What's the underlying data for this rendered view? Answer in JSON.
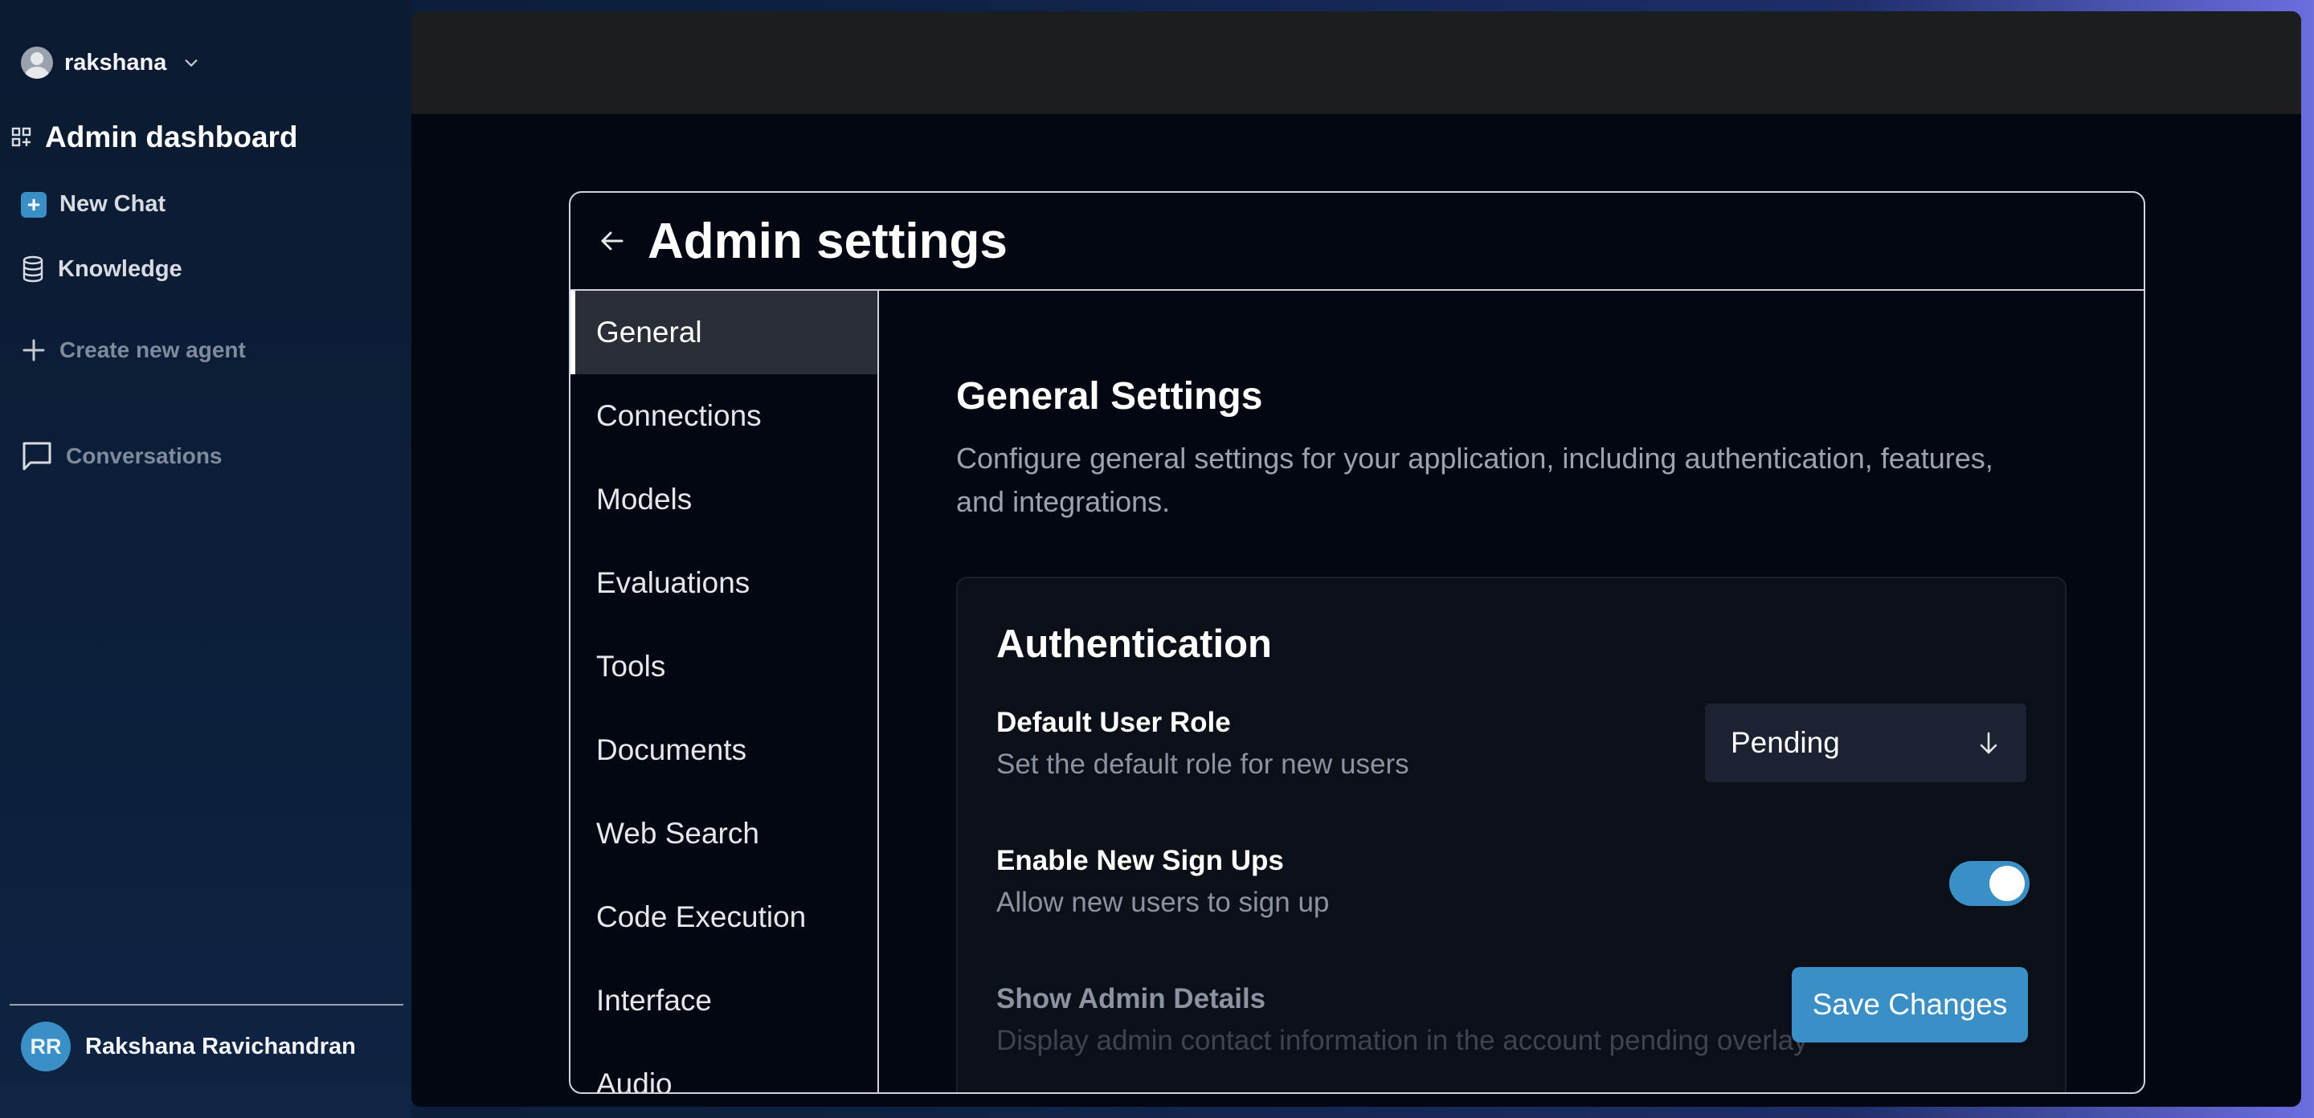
{
  "sidebar": {
    "user_name": "rakshana",
    "admin_title": "Admin dashboard",
    "new_chat": "New Chat",
    "knowledge": "Knowledge",
    "create_agent": "Create new agent",
    "conversations": "Conversations",
    "bottom_user": {
      "initials": "RR",
      "name": "Rakshana Ravichandran"
    }
  },
  "panel": {
    "title": "Admin settings",
    "tabs": [
      {
        "label": "General",
        "active": true
      },
      {
        "label": "Connections"
      },
      {
        "label": "Models"
      },
      {
        "label": "Evaluations"
      },
      {
        "label": "Tools"
      },
      {
        "label": "Documents"
      },
      {
        "label": "Web Search"
      },
      {
        "label": "Code Execution"
      },
      {
        "label": "Interface"
      },
      {
        "label": "Audio"
      }
    ],
    "section_title": "General Settings",
    "section_desc": "Configure general settings for your application, including authentication, features, and integrations.",
    "auth": {
      "title": "Authentication",
      "default_role_label": "Default User Role",
      "default_role_desc": "Set the default role for new users",
      "default_role_value": "Pending",
      "signup_label": "Enable New Sign Ups",
      "signup_desc": "Allow new users to sign up",
      "signup_enabled": true,
      "admin_details_label": "Show Admin Details",
      "admin_details_desc": "Display admin contact information in the account pending overlay"
    },
    "save_label": "Save Changes"
  },
  "colors": {
    "accent": "#3a8fc7",
    "background": "#030712",
    "topbar": "#1c1d1f"
  }
}
